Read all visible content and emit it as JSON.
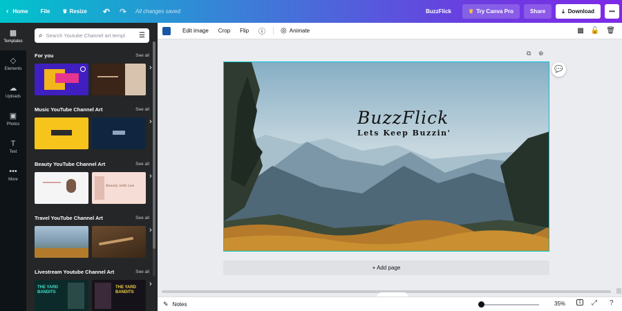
{
  "topbar": {
    "home": "Home",
    "file": "File",
    "resize": "Resize",
    "saved": "All changes saved",
    "brand": "BuzzFlick",
    "try_pro": "Try Canva Pro",
    "share": "Share",
    "download": "Download",
    "more": "•••"
  },
  "rail": {
    "items": [
      {
        "label": "Templates",
        "icon": "templates-icon"
      },
      {
        "label": "Elements",
        "icon": "elements-icon"
      },
      {
        "label": "Uploads",
        "icon": "upload-icon"
      },
      {
        "label": "Photos",
        "icon": "photos-icon"
      },
      {
        "label": "Text",
        "icon": "text-icon"
      },
      {
        "label": "More",
        "icon": "more-icon"
      }
    ]
  },
  "panel": {
    "search_placeholder": "Search Youtube Channel art templ",
    "see_all": "See all",
    "sections": [
      {
        "title": "For you"
      },
      {
        "title": "Music YouTube Channel Art"
      },
      {
        "title": "Beauty YouTube Channel Art"
      },
      {
        "title": "Travel YouTube Channel Art"
      },
      {
        "title": "Livestream Youtube Channel Art"
      }
    ],
    "thumb_text": {
      "beauty": "Beauty with Lee",
      "yard1": "THE YARD BANDITS",
      "yard2": "THE YARD BANDITS"
    }
  },
  "editor_toolbar": {
    "color": "#1656a4",
    "edit_image": "Edit image",
    "crop": "Crop",
    "flip": "Flip",
    "animate": "Animate"
  },
  "design": {
    "title": "BuzzFlick",
    "subtitle": "Lets Keep Buzzin'"
  },
  "canvas": {
    "add_page": "+ Add page"
  },
  "bottombar": {
    "notes": "Notes",
    "zoom": "35%",
    "zoom_fraction": 0.0,
    "page_count": "1"
  },
  "colors": {
    "accent": "#00c4cc",
    "purple": "#7d2ae8",
    "dark": "#0e1318"
  }
}
